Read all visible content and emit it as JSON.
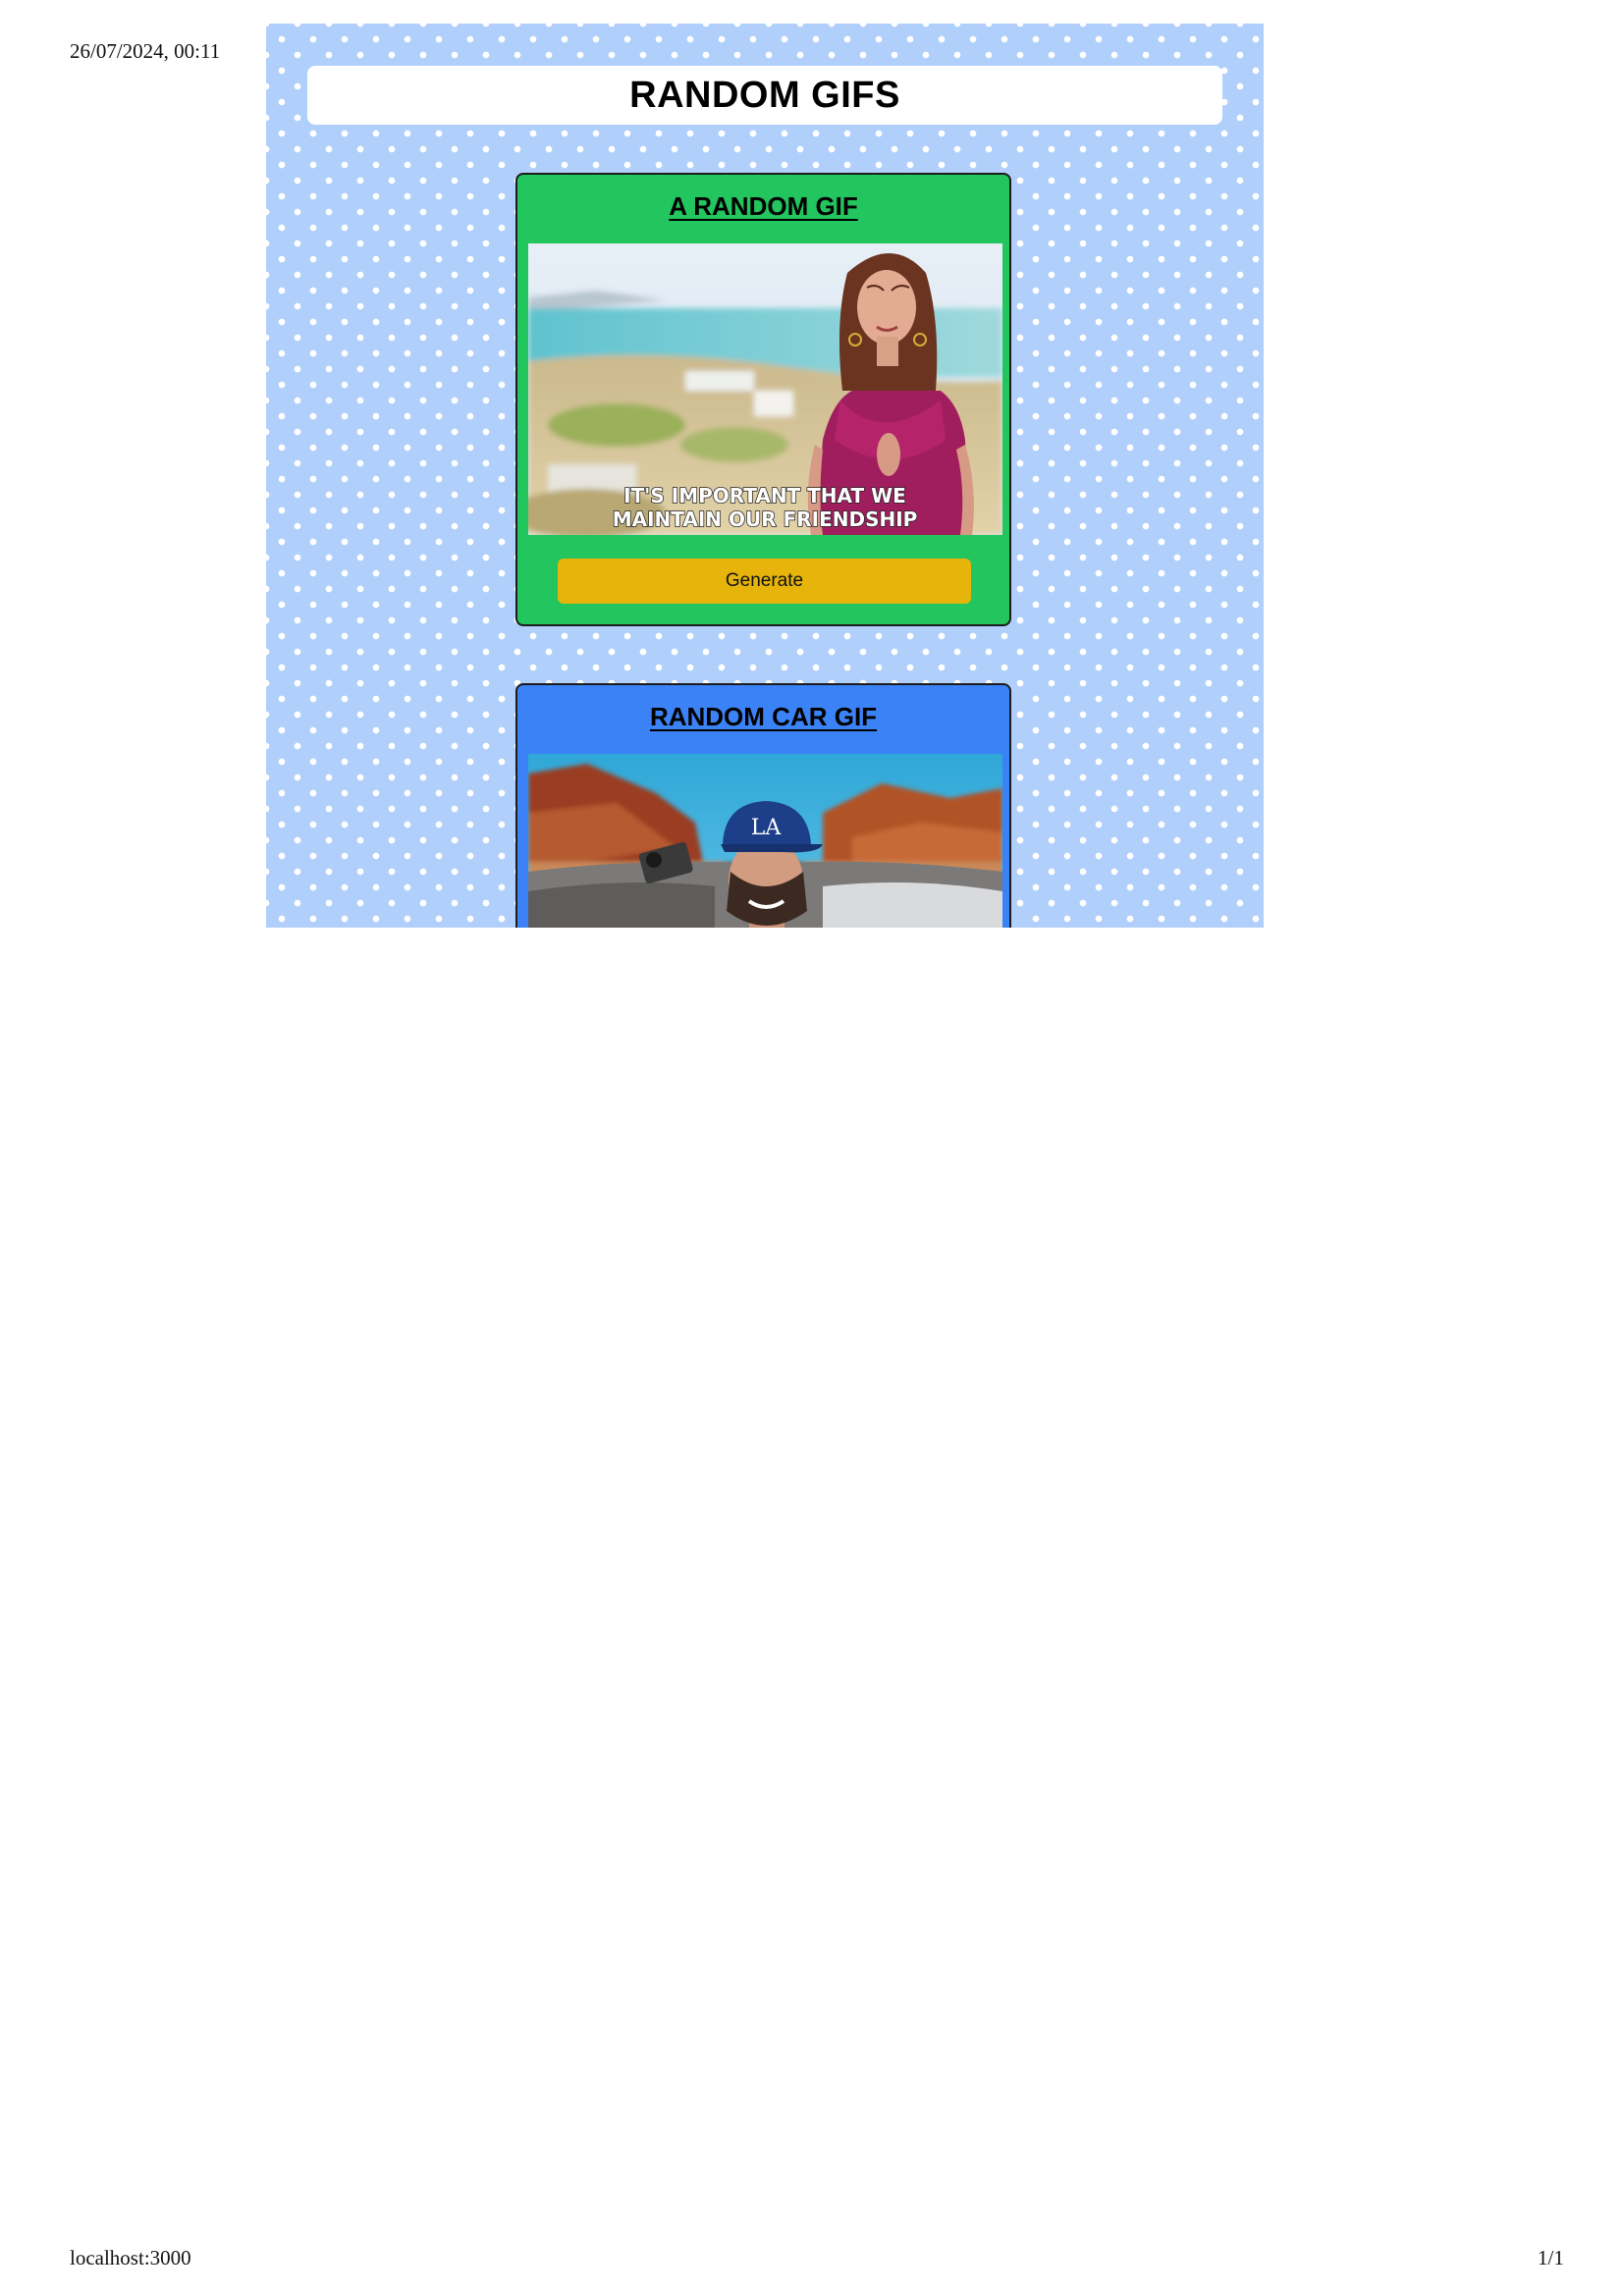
{
  "print": {
    "date": "26/07/2024, 00:11",
    "url": "localhost:3000",
    "page": "1/1"
  },
  "page": {
    "title": "RANDOM GIFS",
    "background_color": "#b1cffb",
    "dot_color": "#ffffff"
  },
  "cards": [
    {
      "title": "A RANDOM GIF",
      "color": "#22c55e",
      "gif_caption_line1": "IT'S IMPORTANT THAT WE",
      "gif_caption_line2": "MAINTAIN OUR FRIENDSHIP",
      "button_label": "Generate",
      "button_color": "#e6b40a"
    },
    {
      "title": "RANDOM CAR GIF",
      "color": "#3b82f6"
    }
  ]
}
